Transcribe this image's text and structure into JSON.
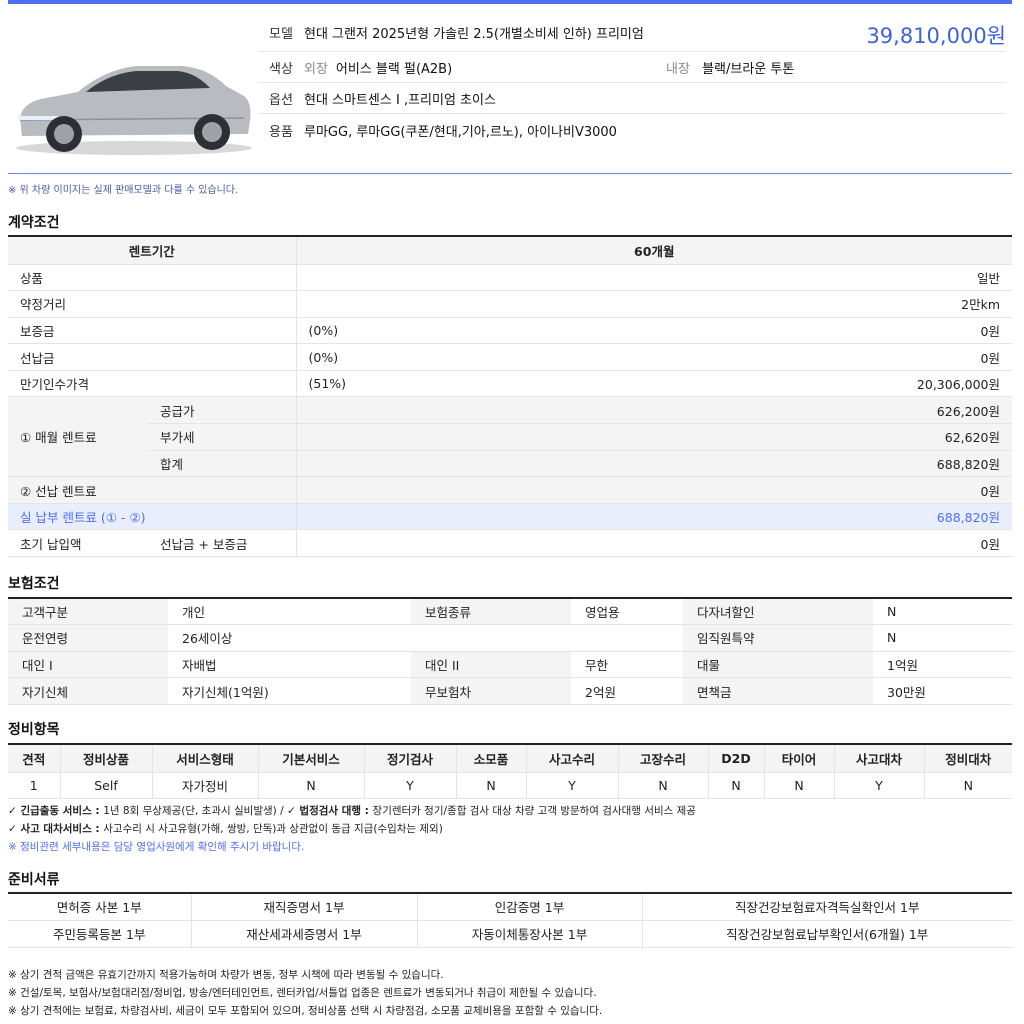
{
  "car": {
    "model_key": "모델",
    "model": "현대 그랜저 2025년형 가솔린 2.5(개별소비세 인하) 프리미엄",
    "price": "39,810,000원",
    "color_key": "색상",
    "ext_label": "외장",
    "ext": "어비스 블랙 펄(A2B)",
    "int_label": "내장",
    "int": "블랙/브라운 투톤",
    "option_key": "옵션",
    "option": "현대 스마트센스 Ⅰ ,프리미엄 초이스",
    "goods_key": "용품",
    "goods": "루마GG, 루마GG(쿠폰/현대,기아,르노), 아이나비V3000",
    "image_note": "※ 위 차량 이미지는 실제 판매모델과 다를 수 있습니다."
  },
  "contract": {
    "title": "계약조건",
    "period_label": "렌트기간",
    "period": "60개월",
    "rows": [
      {
        "label": "상품",
        "pct": "",
        "value": "일반"
      },
      {
        "label": "약정거리",
        "pct": "",
        "value": "2만km"
      },
      {
        "label": "보증금",
        "pct": "(0%)",
        "value": "0원"
      },
      {
        "label": "선납금",
        "pct": "(0%)",
        "value": "0원"
      },
      {
        "label": "만기인수가격",
        "pct": "(51%)",
        "value": "20,306,000원"
      }
    ],
    "monthly_label": "① 매월 렌트료",
    "supply_label": "공급가",
    "supply": "626,200원",
    "vat_label": "부가세",
    "vat": "62,620원",
    "sum_label": "합계",
    "sum": "688,820원",
    "prepaid_label": "② 선납 렌트료",
    "prepaid": "0원",
    "actual_label": "실 납부 렌트료 (① - ②)",
    "actual": "688,820원",
    "initial_label": "초기 납입액",
    "initial_sub": "선납금 + 보증금",
    "initial": "0원"
  },
  "insurance": {
    "title": "보험조건",
    "r1": [
      "고객구분",
      "개인",
      "보험종류",
      "영업용",
      "다자녀할인",
      "N"
    ],
    "r2": [
      "운전연령",
      "26세이상",
      "임직원특약",
      "N"
    ],
    "r3": [
      "대인 I",
      "자배법",
      "대인 II",
      "무한",
      "대물",
      "1억원"
    ],
    "r4": [
      "자기신체",
      "자기신체(1억원)",
      "무보험차",
      "2억원",
      "면책금",
      "30만원"
    ]
  },
  "maintenance": {
    "title": "정비항목",
    "headers": [
      "견적",
      "정비상품",
      "서비스형태",
      "기본서비스",
      "정기검사",
      "소모품",
      "사고수리",
      "고장수리",
      "D2D",
      "타이어",
      "사고대차",
      "정비대차"
    ],
    "row": [
      "1",
      "Self",
      "자가정비",
      "N",
      "Y",
      "N",
      "Y",
      "N",
      "N",
      "N",
      "Y",
      "N"
    ],
    "note1_a": "✓ 긴급출동 서비스 : ",
    "note1_b": "1년 8회 무상제공(단, 초과시 실비발생) / ",
    "note1_c": "✓ 법정검사 대행 : ",
    "note1_d": "장기렌터카 정기/종합 검사 대상 차량 고객 방문하여 검사대행 서비스 제공",
    "note2_a": "✓ 사고 대차서비스 : ",
    "note2_b": "사고수리 시 사고유형(가해, 쌍방, 단독)과 상관없이 동급 지급(수입차는 제외)",
    "note3": "※ 정비관련 세부내용은 담당 영업사원에게 확인해 주시기 바랍니다."
  },
  "docs": {
    "title": "준비서류",
    "r1": [
      "면허증 사본 1부",
      "재직증명서 1부",
      "인감증명 1부",
      "직장건강보험료자격득실확인서 1부"
    ],
    "r2": [
      "주민등록등본 1부",
      "재산세과세증명서 1부",
      "자동이체통장사본 1부",
      "직장건강보험료납부확인서(6개월) 1부"
    ]
  },
  "footer": [
    "※ 상기 견적 금액은 유효기간까지 적용가능하며 차량가 변동, 정부 시책에 따라 변동될 수 있습니다.",
    "※ 건설/토목, 보험사/보험대리점/정비업, 방송/엔터테인먼트, 렌터카업/서틀업 업종은 렌트료가 변동되거나 취급이 제한될 수 있습니다.",
    "※ 상기 견적에는 보험료, 차량검사비, 세금이 모두 포함되어 있으며, 정비상품 선택 시 차량점검, 소모품 교체비용을 포함할 수 있습니다."
  ]
}
